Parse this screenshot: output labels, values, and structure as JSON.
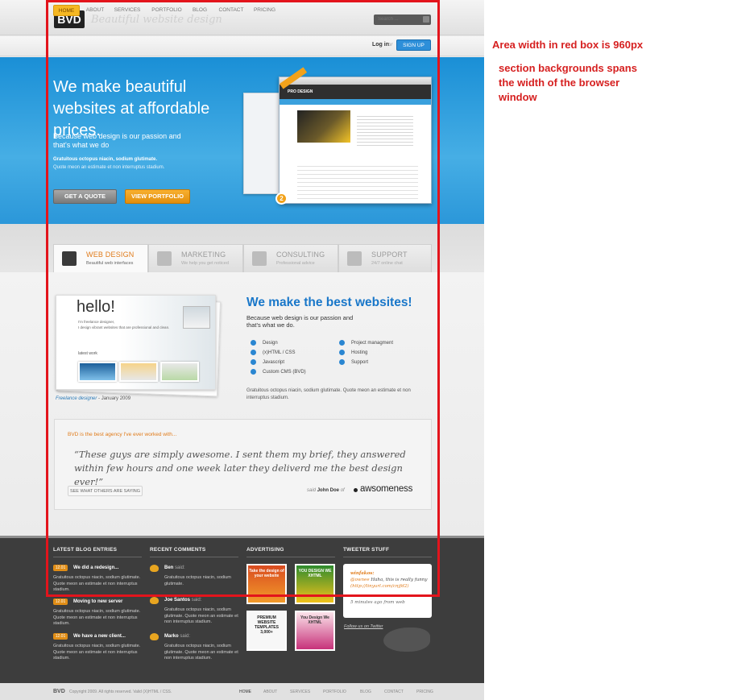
{
  "header": {
    "logo": "BVD",
    "tagline": "Beautiful website design",
    "search_placeholder": "Search ...",
    "nav": [
      "HOME",
      "ABOUT",
      "SERVICES",
      "PORTFOLIO",
      "BLOG",
      "CONTACT",
      "PRICING"
    ],
    "login": "Log in",
    "login_or": "or",
    "signup": "SIGN UP"
  },
  "hero": {
    "headline": "We make beautiful websites at affordable prices.",
    "subtext": "Because web design is our passion and that's what we do",
    "bold_line": "Gratuitous octopus niacin, sodium glutimate.",
    "small_line": "Quote meon an estimate et non interruptus stadium.",
    "btn_quote": "GET A QUOTE",
    "btn_portfolio": "VIEW PORTFOLIO",
    "screenshot_title": "PRO DESIGN",
    "badge": "2"
  },
  "tabs": [
    {
      "title": "WEB DESIGN",
      "sub": "Beautiful web interfaces",
      "icon": "monitor-icon"
    },
    {
      "title": "MARKETING",
      "sub": "We help you get noticed",
      "icon": "chart-icon"
    },
    {
      "title": "CONSULTING",
      "sub": "Professional advice",
      "icon": "clipboard-icon"
    },
    {
      "title": "SUPPORT",
      "sub": "24/7 online chat",
      "icon": "person-icon"
    }
  ],
  "portfolio": {
    "hello": "hello!",
    "intro1": "I'm freelance designer,",
    "intro2": "I design vibrant websites that are professional and clean.",
    "latest": "latest work",
    "caption_role": "Freelance designer",
    "caption_date": " - January 2009"
  },
  "marketing": {
    "title": "We make the best websites!",
    "sub": "Because web design is our passion and that's what we do.",
    "features_left": [
      "Design",
      "(x)HTML / CSS",
      "Javascript",
      "Custom CMS (BVD)"
    ],
    "features_right": [
      "Project managment",
      "Hosting",
      "Support"
    ],
    "para": "Gratuitous octopus niacin, sodium glutimate. Quote meon an estimate et non interruptus stadium."
  },
  "testimonial": {
    "heading": "BVD is the best agency I've ever worked with...",
    "quote": "“These guys are simply awesome. I sent them my brief, they answered within few hours and one week later they deliverd me the best design ever!”",
    "button": "SEE WHAT OTHERS ARE SAYING",
    "said": "said",
    "author": "John Doe",
    "of": "of",
    "company": "awsomeness"
  },
  "footer": {
    "blog_heading": "LATEST BLOG ENTRIES",
    "comments_heading": "RECENT COMMENTS",
    "ads_heading": "ADVERTISING",
    "tweet_heading": "TWEETER STUFF",
    "blog": [
      {
        "date": "12.01",
        "title": "We did a redesign..."
      },
      {
        "date": "12.01",
        "title": "Moving to new server"
      },
      {
        "date": "12.01",
        "title": "We have a new client..."
      }
    ],
    "blog_para": "Gratuitous octopus niacin, sodium glutimate. Quote meon an estimate et non interruptus stadium.",
    "comments": [
      {
        "name": "Ben",
        "said": "said:"
      },
      {
        "name": "Joe Santos",
        "said": "said:"
      },
      {
        "name": "Marko",
        "said": "said:"
      }
    ],
    "comment_para": "Gratuitous octopus niacin, sodium glutimate.",
    "comment_para_long": "Gratuitous octopus niacin, sodium glutimate. Quote meon an estimate et non interruptus stadium.",
    "ads": [
      "Take the design of your website",
      "YOU DESIGN WE XHTML",
      "PREMIUM WEBSITE TEMPLATES 3,000+",
      "You Design We XHTML"
    ],
    "tweet_user": "winfakos:",
    "tweet_at": "@ownee",
    "tweet_body": "Haha, this is really funny",
    "tweet_link": "(http://tinyurl.com/cnjfd2)",
    "tweet_time": "5 minutes ago from web",
    "follow": "Follow us on Twitter"
  },
  "bottom": {
    "logo": "BVD",
    "copyright": "Copyright 2009. All rights reserved. Valid (X)HTML / CSS.",
    "nav": [
      "HOME",
      "ABOUT",
      "SERVICES",
      "PORTFOLIO",
      "BLOG",
      "CONTACT",
      "PRICING"
    ]
  },
  "annotations": {
    "width_note": "Area width in red box is 960px",
    "bg_note": "section backgrounds spans the width of the browser window"
  },
  "colors": {
    "accent": "#e3141c",
    "brand_blue": "#1977c9",
    "orange": "#e07b1a"
  }
}
